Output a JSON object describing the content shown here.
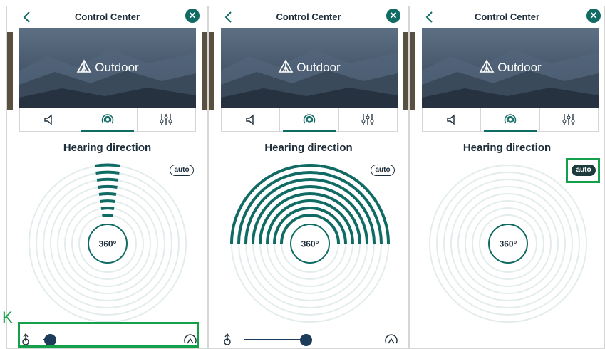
{
  "panels": [
    {
      "title": "Control Center",
      "hero_label": "Outdoor",
      "heading": "Hearing direction",
      "auto_label": "auto",
      "auto_on": false,
      "center_label": "360°",
      "mode": "narrow",
      "slider_fraction": 0.05
    },
    {
      "title": "Control Center",
      "hero_label": "Outdoor",
      "heading": "Hearing direction",
      "auto_label": "auto",
      "auto_on": false,
      "center_label": "360°",
      "mode": "wide",
      "slider_fraction": 0.45
    },
    {
      "title": "Control Center",
      "hero_label": "Outdoor",
      "heading": "Hearing direction",
      "auto_label": "auto",
      "auto_on": true,
      "center_label": "360°",
      "mode": "none",
      "slider_fraction": null
    }
  ],
  "tabs": [
    {
      "name": "volume",
      "icon": "speaker-icon"
    },
    {
      "name": "hearing-direction",
      "icon": "hearing-direction-icon",
      "active": true
    },
    {
      "name": "equalizer",
      "icon": "equalizer-icon"
    }
  ],
  "slider_icons": {
    "left": "focus-icon",
    "right": "surround-icon"
  },
  "annotation": {
    "label": "K"
  },
  "colors": {
    "accent": "#0f6b63",
    "ring": "#e3ecec",
    "knob": "#1d3b5a",
    "highlight": "#14a04a"
  }
}
